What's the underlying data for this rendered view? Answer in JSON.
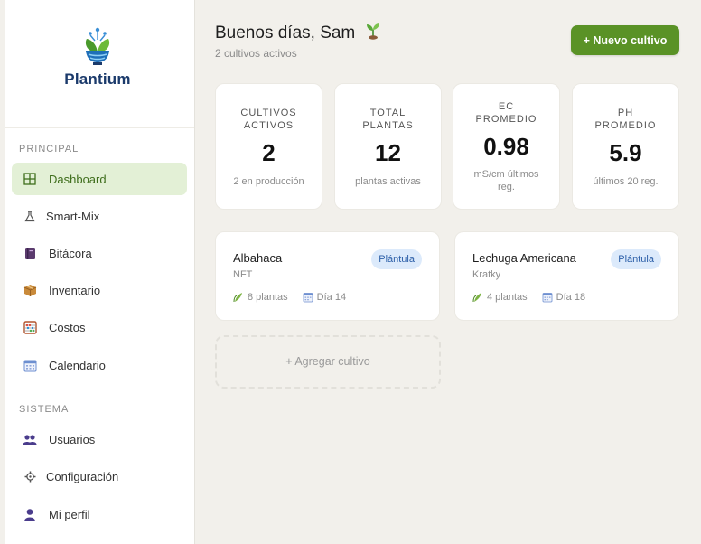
{
  "brand": {
    "name": "Plantium"
  },
  "sidebar": {
    "sections": [
      {
        "label": "PRINCIPAL"
      },
      {
        "label": "SISTEMA"
      }
    ],
    "items": [
      {
        "label": "Dashboard",
        "icon": "grid-icon"
      },
      {
        "label": "Smart-Mix",
        "icon": "flask-icon"
      },
      {
        "label": "Bitácora",
        "icon": "book-icon"
      },
      {
        "label": "Inventario",
        "icon": "box-icon"
      },
      {
        "label": "Costos",
        "icon": "abacus-icon"
      },
      {
        "label": "Calendario",
        "icon": "calendar-icon"
      },
      {
        "label": "Usuarios",
        "icon": "users-icon"
      },
      {
        "label": "Configuración",
        "icon": "gear-icon"
      },
      {
        "label": "Mi perfil",
        "icon": "user-icon"
      }
    ]
  },
  "header": {
    "greeting": "Buenos días, Sam",
    "subtitle": "2 cultivos activos",
    "new_button": "+ Nuevo cultivo"
  },
  "stats": [
    {
      "label": "CULTIVOS ACTIVOS",
      "value": "2",
      "sub": "2 en producción"
    },
    {
      "label": "TOTAL PLANTAS",
      "value": "12",
      "sub": "plantas activas"
    },
    {
      "label": "EC PROMEDIO",
      "value": "0.98",
      "sub": "mS/cm últimos reg."
    },
    {
      "label": "PH PROMEDIO",
      "value": "5.9",
      "sub": "últimos 20 reg."
    }
  ],
  "crops": [
    {
      "name": "Albahaca",
      "method": "NFT",
      "stage": "Plántula",
      "plants": "8 plantas",
      "day": "Día 14"
    },
    {
      "name": "Lechuga Americana",
      "method": "Kratky",
      "stage": "Plántula",
      "plants": "4 plantas",
      "day": "Día 18"
    }
  ],
  "add_crop": "+ Agregar cultivo",
  "colors": {
    "accent": "#5a9226",
    "active_bg": "#e3f0d6",
    "badge_bg": "#dceafb",
    "badge_text": "#2c5fa8"
  }
}
